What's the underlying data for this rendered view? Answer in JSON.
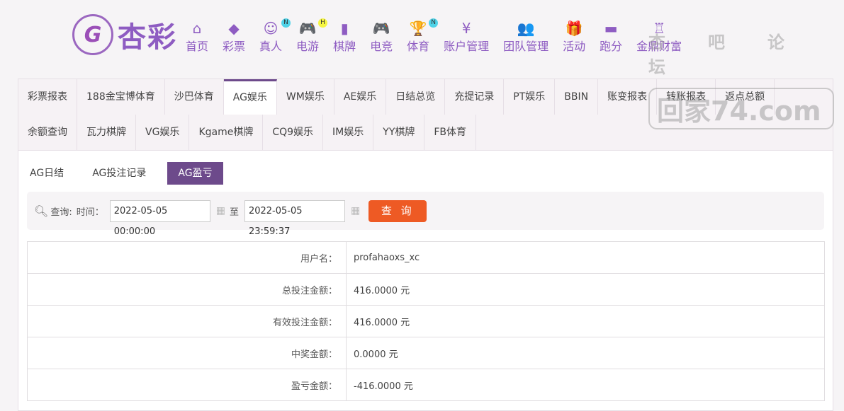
{
  "logo": {
    "text": "杏彩"
  },
  "nav": [
    {
      "label": "首页",
      "icon": "home-icon",
      "glyph": "⌂",
      "badge": ""
    },
    {
      "label": "彩票",
      "icon": "ticket-icon",
      "glyph": "◆",
      "badge": ""
    },
    {
      "label": "真人",
      "icon": "dealer-icon",
      "glyph": "☺",
      "badge": "N"
    },
    {
      "label": "电游",
      "icon": "gamepad-icon",
      "glyph": "🎮",
      "badge": "H"
    },
    {
      "label": "棋牌",
      "icon": "cards-icon",
      "glyph": "▮",
      "badge": ""
    },
    {
      "label": "电竞",
      "icon": "gamepad-icon",
      "glyph": "🎮",
      "badge": ""
    },
    {
      "label": "体育",
      "icon": "trophy-icon",
      "glyph": "🏆",
      "badge": "N"
    },
    {
      "label": "账户管理",
      "icon": "yen-icon",
      "glyph": "¥",
      "badge": ""
    },
    {
      "label": "团队管理",
      "icon": "team-icon",
      "glyph": "👥",
      "badge": ""
    },
    {
      "label": "活动",
      "icon": "gift-icon",
      "glyph": "🎁",
      "badge": ""
    },
    {
      "label": "跑分",
      "icon": "rhino-icon",
      "glyph": "▬",
      "badge": ""
    },
    {
      "label": "金鼎财富",
      "icon": "cauldron-icon",
      "glyph": "♖",
      "badge": ""
    }
  ],
  "badge_colors": {
    "N": "#4fd3e8",
    "H": "#f5f542"
  },
  "tabs_row1": [
    "彩票报表",
    "188金宝博体育",
    "沙巴体育",
    "AG娱乐",
    "WM娱乐",
    "AE娱乐",
    "日结总览",
    "充提记录",
    "PT娱乐",
    "BBIN",
    "账变报表",
    "转账报表",
    "返点总额"
  ],
  "tabs_row2": [
    "余额查询",
    "瓦力棋牌",
    "VG娱乐",
    "Kgame棋牌",
    "CQ9娱乐",
    "IM娱乐",
    "YY棋牌",
    "FB体育"
  ],
  "active_tab": "AG娱乐",
  "sub_tabs": [
    "AG日结",
    "AG投注记录",
    "AG盈亏"
  ],
  "active_sub_tab": "AG盈亏",
  "query": {
    "label": "查询:",
    "time_label": "时间：",
    "start": "2022-05-05 00:00:00",
    "to": "至",
    "end": "2022-05-05 23:59:37",
    "button": "查 询"
  },
  "rows": [
    {
      "label": "用户名：",
      "value": "profahaoxs_xc"
    },
    {
      "label": "总投注金额：",
      "value": "416.0000 元"
    },
    {
      "label": "有效投注金额：",
      "value": "416.0000 元"
    },
    {
      "label": "中奖金额：",
      "value": "0.0000 元"
    },
    {
      "label": "盈亏金额：",
      "value": "-416.0000 元"
    }
  ],
  "watermark": {
    "line1": "杏吧论坛",
    "line2": "回家74.com"
  },
  "colors": {
    "brand": "#8e5cc2",
    "active": "#6d4a8b",
    "button": "#ee5a24"
  }
}
